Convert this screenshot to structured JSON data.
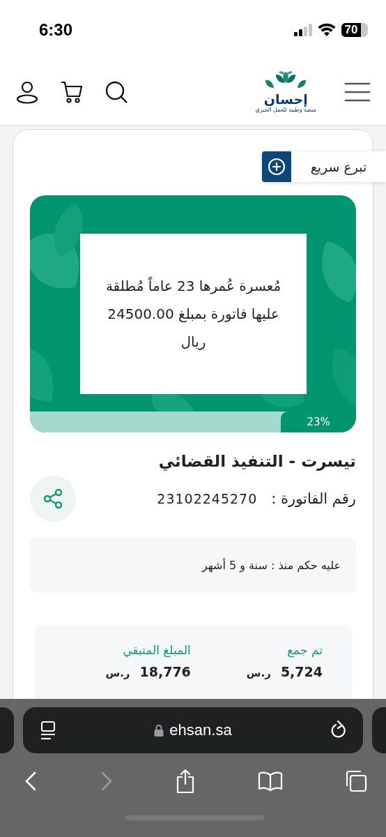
{
  "status_bar": {
    "time": "6:30",
    "battery": "70"
  },
  "header": {
    "logo_name": "إحسان",
    "logo_tagline": "منصة وطنية للعمل الخيري"
  },
  "quick_donate": {
    "label": "تبرع سريع"
  },
  "campaign": {
    "banner_text": "مُعسرة عُمرها 23 عاماً مُطلقة عليها فاتورة بمبلغ 24500.00 ريال",
    "progress": {
      "level": 0.23,
      "percent": "23%"
    },
    "title": "تيسرت - التنفيذ القضائي",
    "invoice_label": "رقم الفاتورة :",
    "invoice_number": "23102245270",
    "judgment": "عليه حكم منذ : سنة و 5 أشهر",
    "stats": [
      {
        "label": "تم جمع",
        "amount": "5,724",
        "currency": "ر.س"
      },
      {
        "label": "المبلغ المتبقي",
        "amount": "18,776",
        "currency": "ر.س"
      }
    ]
  },
  "browser": {
    "url": "ehsan.sa",
    "back_disabled": false,
    "forward_disabled": true
  }
}
